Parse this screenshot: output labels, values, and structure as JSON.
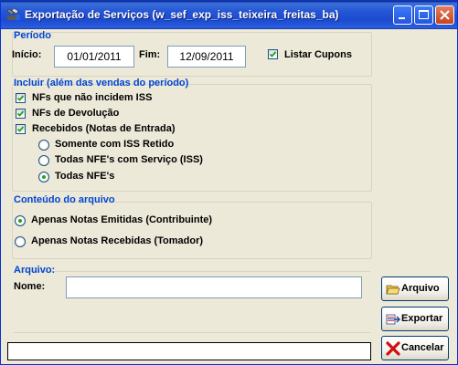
{
  "window": {
    "title": "Exportação de Serviços (w_sef_exp_iss_teixeira_freitas_ba)"
  },
  "periodo": {
    "heading": "Período",
    "inicio_label": "Início:",
    "inicio_value": "01/01/2011",
    "fim_label": "Fim:",
    "fim_value": "12/09/2011",
    "listar_cupons_label": "Listar Cupons",
    "listar_cupons_checked": true
  },
  "incluir": {
    "heading": "Incluir (além das vendas do período)",
    "nfs_nao_incidem_label": "NFs que não incidem ISS",
    "nfs_devolucao_label": "NFs de Devolução",
    "recebidos_label": "Recebidos (Notas de Entrada)",
    "options": [
      {
        "label": "Somente com ISS Retido",
        "selected": false
      },
      {
        "label": "Todas NFE's com Serviço (ISS)",
        "selected": false
      },
      {
        "label": "Todas NFE's",
        "selected": true
      }
    ]
  },
  "conteudo": {
    "heading": "Conteúdo do arquivo",
    "options": [
      {
        "label": "Apenas Notas Emitidas (Contribuinte)",
        "selected": true
      },
      {
        "label": "Apenas Notas Recebidas (Tomador)",
        "selected": false
      }
    ]
  },
  "arquivo": {
    "heading": "Arquivo:",
    "nome_label": "Nome:",
    "nome_value": ""
  },
  "buttons": {
    "arquivo": "Arquivo",
    "exportar": "Exportar",
    "cancelar": "Cancelar"
  },
  "status_text": ""
}
